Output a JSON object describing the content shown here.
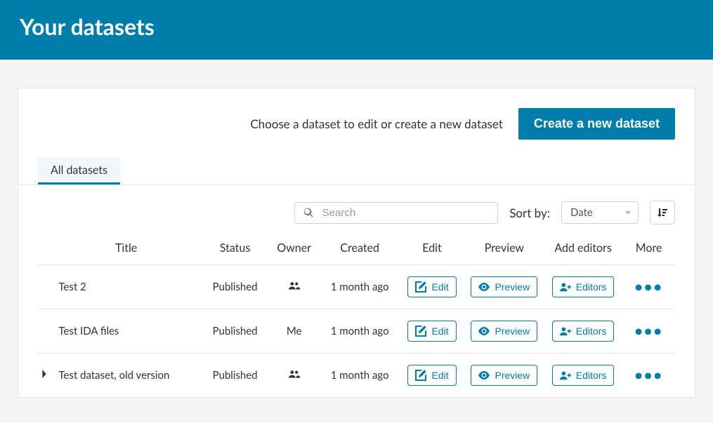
{
  "header": {
    "title": "Your datasets"
  },
  "topbar": {
    "instruction": "Choose a dataset to edit or create a new dataset",
    "create_btn": "Create a new dataset"
  },
  "tabs": {
    "all": "All datasets"
  },
  "search": {
    "placeholder": "Search"
  },
  "sort": {
    "label": "Sort by:",
    "selected": "Date"
  },
  "columns": {
    "title": "Title",
    "status": "Status",
    "owner": "Owner",
    "created": "Created",
    "edit": "Edit",
    "preview": "Preview",
    "add_editors": "Add editors",
    "more": "More"
  },
  "buttons": {
    "edit": "Edit",
    "preview": "Preview",
    "editors": "Editors"
  },
  "rows": [
    {
      "title": "Test 2",
      "status": "Published",
      "owner": "group",
      "created": "1 month ago",
      "expandable": false
    },
    {
      "title": "Test IDA files",
      "status": "Published",
      "owner": "Me",
      "created": "1 month ago",
      "expandable": false
    },
    {
      "title": "Test dataset, old version",
      "status": "Published",
      "owner": "group",
      "created": "1 month ago",
      "expandable": true
    }
  ]
}
